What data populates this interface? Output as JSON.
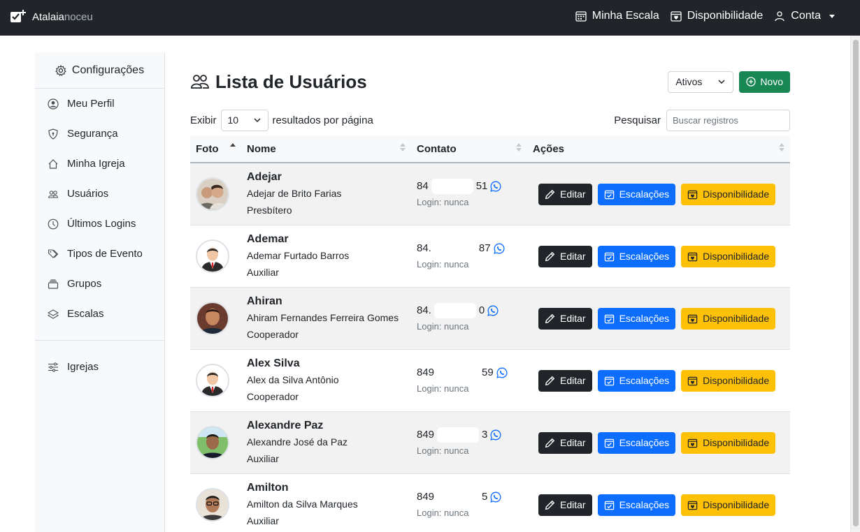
{
  "navbar": {
    "brand_part1": "Atalaia",
    "brand_part2": "noceu",
    "my_schedule": "Minha Escala",
    "availability": "Disponibilidade",
    "account": "Conta"
  },
  "sidebar": {
    "header": "Configurações",
    "items": [
      {
        "label": "Meu Perfil",
        "icon": "person-circle-icon"
      },
      {
        "label": "Segurança",
        "icon": "shield-icon"
      },
      {
        "label": "Minha Igreja",
        "icon": "house-icon"
      },
      {
        "label": "Usuários",
        "icon": "people-icon"
      },
      {
        "label": "Últimos Logins",
        "icon": "clock-icon"
      },
      {
        "label": "Tipos de Evento",
        "icon": "tags-icon"
      },
      {
        "label": "Grupos",
        "icon": "collection-icon"
      },
      {
        "label": "Escalas",
        "icon": "layers-icon"
      }
    ],
    "bottom_items": [
      {
        "label": "Igrejas",
        "icon": "sliders-icon"
      }
    ]
  },
  "main": {
    "title": "Lista de Usuários",
    "status_filter": "Ativos",
    "new_button": "Novo",
    "show_label": "Exibir",
    "page_length": "10",
    "per_page_label": "resultados por página",
    "search_label": "Pesquisar",
    "search_placeholder": "Buscar registros"
  },
  "table": {
    "headers": {
      "photo": "Foto",
      "name": "Nome",
      "contact": "Contato",
      "actions": "Ações"
    },
    "action_labels": {
      "edit": "Editar",
      "schedules": "Escalações",
      "availability": "Disponibilidade"
    },
    "rows": [
      {
        "short": "Adejar",
        "full": "Adejar de Brito Farias",
        "role": "Presbítero",
        "phone_start": "84",
        "phone_end": "51",
        "login": "Login: nunca",
        "avatar": "photo-two-people"
      },
      {
        "short": "Ademar",
        "full": "Ademar Furtado Barros",
        "role": "Auxiliar",
        "phone_start": "84.",
        "phone_end": "87",
        "login": "Login: nunca",
        "avatar": "default-avatar"
      },
      {
        "short": "Ahiran",
        "full": "Ahiram Fernandes Ferreira Gomes",
        "role": "Cooperador",
        "phone_start": "84.",
        "phone_end": "0",
        "login": "Login: nunca",
        "avatar": "photo-man"
      },
      {
        "short": "Alex Silva",
        "full": "Alex da Silva Antônio",
        "role": "Cooperador",
        "phone_start": "849",
        "phone_end": "59",
        "login": "Login: nunca",
        "avatar": "default-avatar"
      },
      {
        "short": "Alexandre Paz",
        "full": "Alexandre José da Paz",
        "role": "Auxiliar",
        "phone_start": "849",
        "phone_end": "3",
        "login": "Login: nunca",
        "avatar": "photo-man-green"
      },
      {
        "short": "Amilton",
        "full": "Amilton da Silva Marques",
        "role": "Auxiliar",
        "phone_start": "849",
        "phone_end": "5",
        "login": "Login: nunca",
        "avatar": "photo-man-glasses"
      }
    ]
  },
  "colors": {
    "navbar": "#212529",
    "success": "#198754",
    "primary": "#0d6efd",
    "warning": "#ffc107",
    "whatsapp": "#0d6efd"
  }
}
